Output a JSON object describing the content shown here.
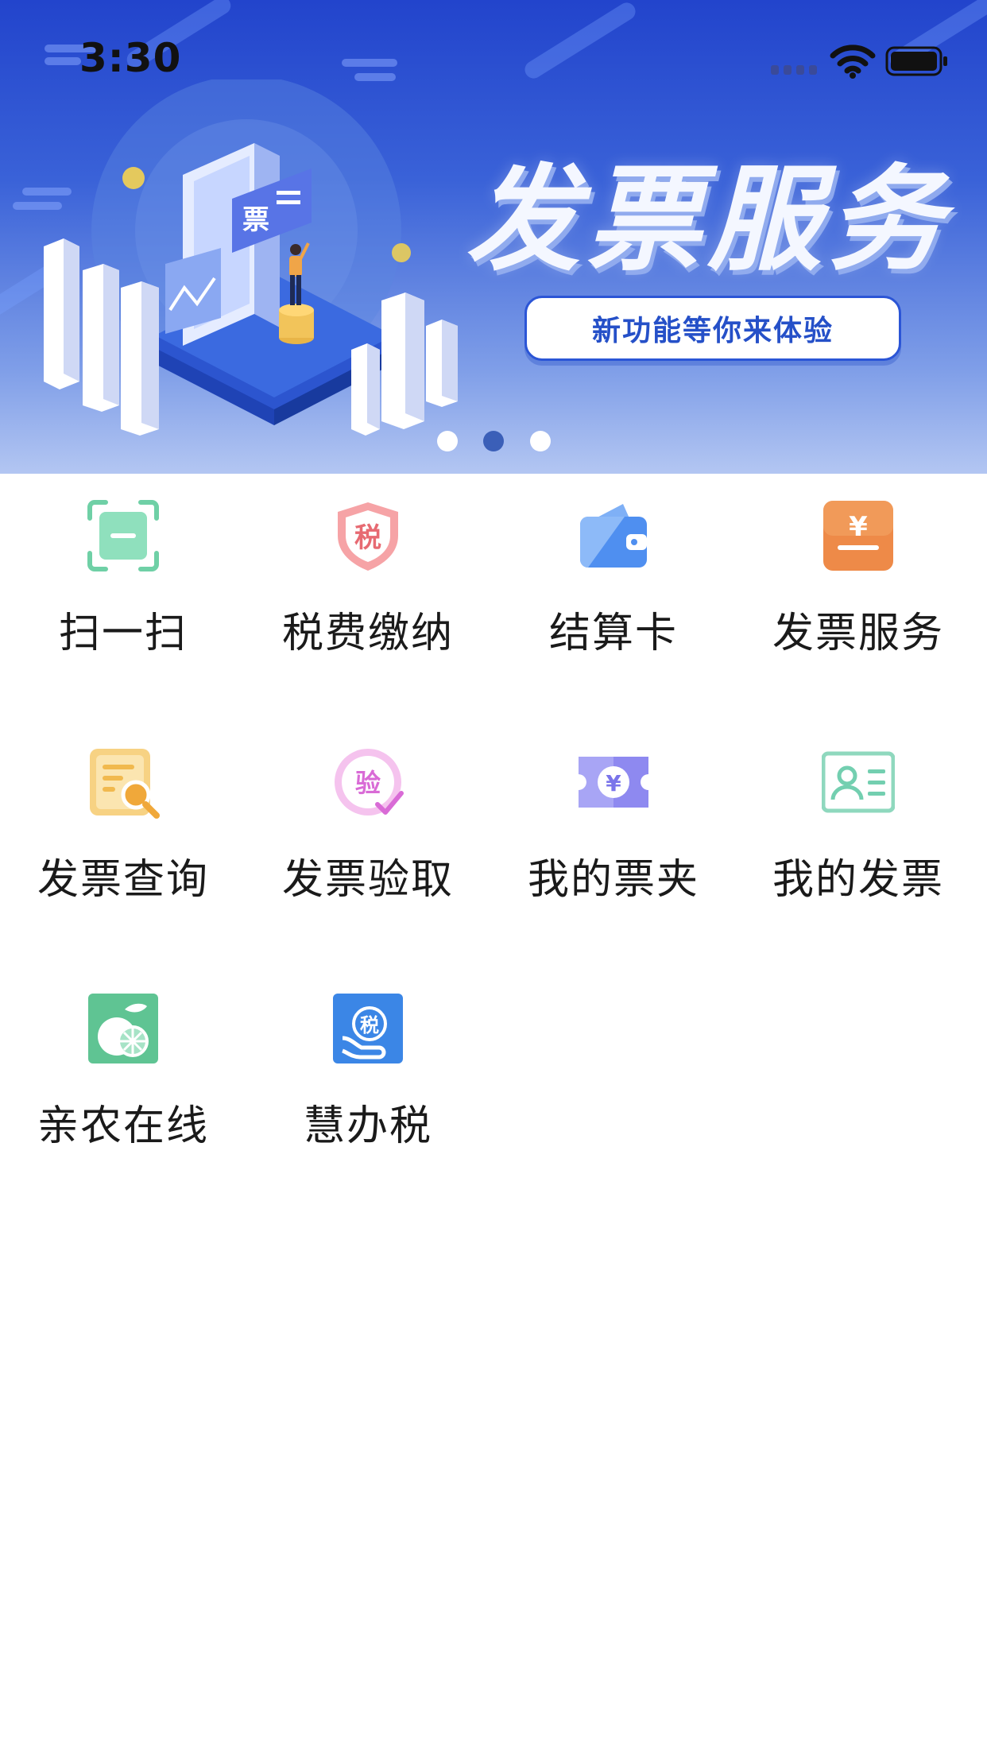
{
  "status_bar": {
    "time": "3:30"
  },
  "banner": {
    "headline": "发票服务",
    "button_label": "新功能等你来体验",
    "ticket_glyph": "票",
    "pager": {
      "count": 3,
      "active_index": 1
    }
  },
  "grid": {
    "items": [
      {
        "label": "扫一扫",
        "icon": "scan-icon",
        "color": "#6fd0a6"
      },
      {
        "label": "税费缴纳",
        "icon": "tax-shield-icon",
        "color": "#ef7a80",
        "glyph": "税"
      },
      {
        "label": "结算卡",
        "icon": "wallet-icon",
        "color": "#4f8ff0"
      },
      {
        "label": "发票服务",
        "icon": "invoice-yen-icon",
        "color": "#ee8a48",
        "glyph": "¥"
      },
      {
        "label": "发票查询",
        "icon": "invoice-search-icon",
        "color": "#f1b94e"
      },
      {
        "label": "发票验取",
        "icon": "verify-icon",
        "color": "#d96bd6",
        "glyph": "验"
      },
      {
        "label": "我的票夹",
        "icon": "ticket-clip-icon",
        "color": "#7a74ea",
        "glyph": "¥"
      },
      {
        "label": "我的发票",
        "icon": "id-card-icon",
        "color": "#73cfb0"
      },
      {
        "label": "亲农在线",
        "icon": "orange-fruit-icon",
        "color": "#5fc493"
      },
      {
        "label": "慧办税",
        "icon": "hand-tax-icon",
        "color": "#3b86e6",
        "glyph": "税"
      }
    ]
  }
}
